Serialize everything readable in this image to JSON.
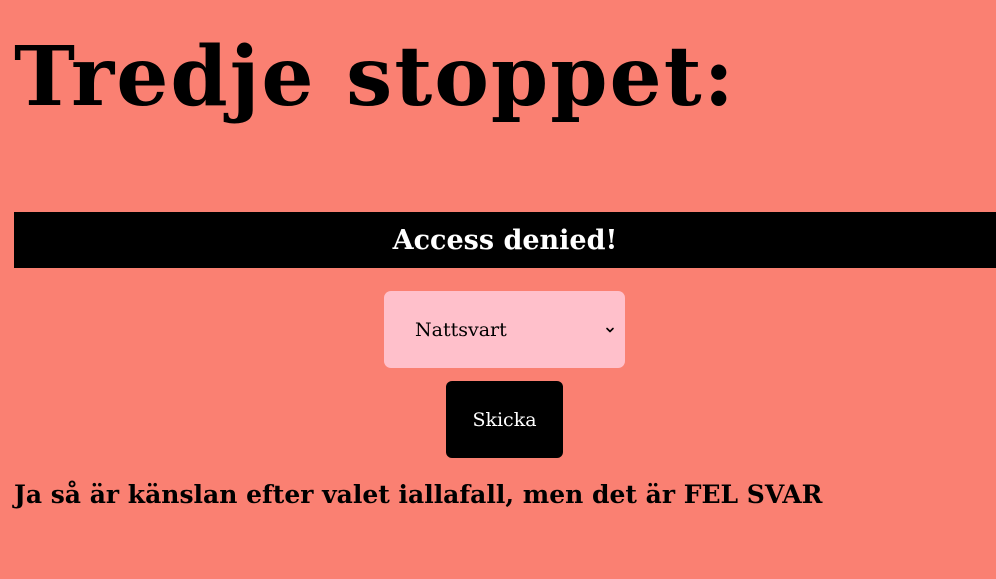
{
  "page": {
    "title": "Tredje stoppet:",
    "background_color": "#fa8072"
  },
  "banner": {
    "text": "Access denied!",
    "background_color": "#000000",
    "text_color": "#ffffff"
  },
  "form": {
    "select": {
      "selected_value": "Nattsvart",
      "background_color": "#ffc0cb",
      "icon": "chevron-down-icon"
    },
    "submit_label": "Skicka"
  },
  "result": {
    "message": "Ja så är känslan efter valet iallafall, men det är FEL SVAR"
  }
}
